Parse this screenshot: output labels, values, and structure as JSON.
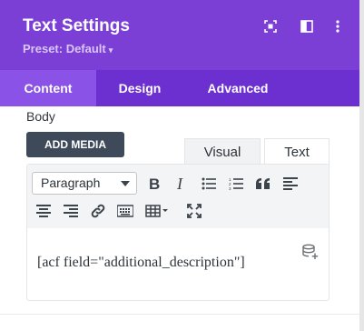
{
  "header": {
    "title": "Text Settings",
    "preset": "Preset: Default",
    "icons": [
      "expand-icon",
      "sidebar-layout-icon",
      "more-vertical-icon"
    ]
  },
  "tabs": [
    {
      "label": "Content",
      "active": true
    },
    {
      "label": "Design",
      "active": false
    },
    {
      "label": "Advanced",
      "active": false
    }
  ],
  "section": {
    "label": "Body"
  },
  "add_media": {
    "label": "ADD MEDIA"
  },
  "editor": {
    "tabs": [
      {
        "label": "Visual",
        "active": false
      },
      {
        "label": "Text",
        "active": true
      }
    ],
    "format_select": "Paragraph",
    "toolbar_icons": [
      "bold-icon",
      "italic-icon",
      "bulleted-list-icon",
      "numbered-list-icon",
      "blockquote-icon",
      "align-left-icon",
      "align-center-icon",
      "align-right-icon",
      "link-icon",
      "keyboard-icon",
      "table-icon",
      "fullscreen-icon"
    ],
    "content": "[acf field=\"additional_description\"]",
    "dynamic_content_icon": "database-plus-icon"
  },
  "colors": {
    "header_bg": "#7c3fd6",
    "tabs_bg": "#6c2fd0",
    "active_tab_bg": "#8b52e8",
    "button_bg": "#3e4a59"
  }
}
